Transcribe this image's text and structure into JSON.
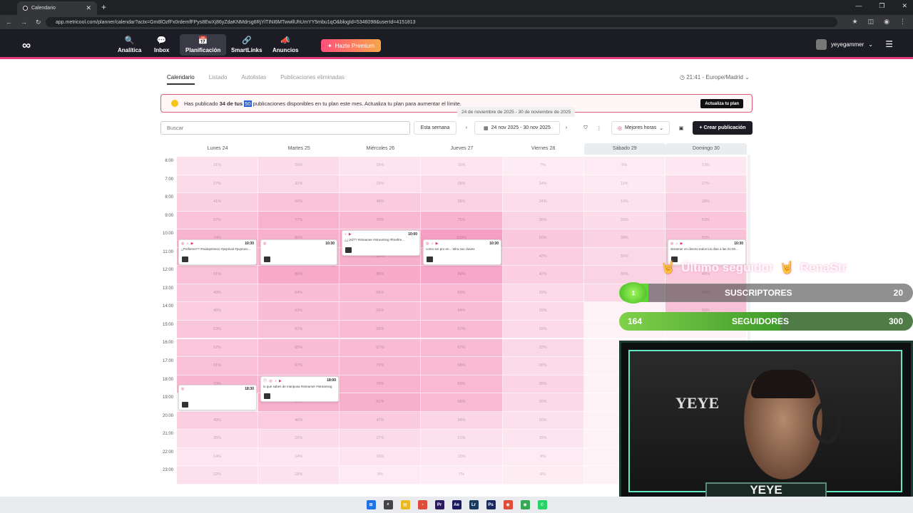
{
  "browser": {
    "tab_title": "Calendario",
    "url": "app.metricool.com/planner/calendar?actx=Gm8lOzfFx0rdemfFPys8EwXj86yZdaKNMdrsg6RjYiTINI6MTwwllUhUmYY5mbu1qO&blogId=5346098&userId=4151813"
  },
  "header": {
    "logo": "∞",
    "nav": [
      {
        "label": "Analítica",
        "icon": "🔍"
      },
      {
        "label": "Inbox",
        "icon": "💬"
      },
      {
        "label": "Planificación",
        "icon": "📅"
      },
      {
        "label": "SmartLinks",
        "icon": "🔗"
      },
      {
        "label": "Anuncios",
        "icon": "📣"
      }
    ],
    "premium_label": "Hazte Premium",
    "username": "yeyegammer"
  },
  "subtabs": [
    "Calendario",
    "Listado",
    "Autolistas",
    "Publicaciones eliminadas"
  ],
  "timezone": "21:41 - Europe/Madrid",
  "banner": {
    "pre": "Has publicado",
    "bold": "34 de tus",
    "highlight": "50",
    "post": "publicaciones disponibles en tu plan este mes. Actualiza tu plan para aumentar el límite.",
    "button": "Actualiza tu plan"
  },
  "tooltip": "24 de noviembre de 2025 - 30 de noviembre de 2025",
  "toolbar": {
    "search_placeholder": "Buscar",
    "this_week": "Esta semana",
    "range": "24 nov 2025 - 30 nov 2025",
    "best_hours": "Mejores horas",
    "create": "+ Crear publicación"
  },
  "days": [
    "Lunes 24",
    "Martes 25",
    "Miércoles 26",
    "Jueves 27",
    "Viernes 28",
    "Sábado 29",
    "Domingo 30"
  ],
  "hours": [
    "6:00",
    "7:00",
    "8:00",
    "9:00",
    "10:00",
    "11:00",
    "12:00",
    "13:00",
    "14:00",
    "15:00",
    "16:00",
    "17:00",
    "18:00",
    "19:00",
    "20:00",
    "21:00",
    "22:00",
    "23:00"
  ],
  "heat": [
    [
      "21%",
      "26%",
      "15%",
      "16%",
      "7%",
      "9%",
      "13%"
    ],
    [
      "27%",
      "31%",
      "23%",
      "28%",
      "14%",
      "11%",
      "27%"
    ],
    [
      "41%",
      "56%",
      "48%",
      "38%",
      "24%",
      "19%",
      "38%"
    ],
    [
      "57%",
      "77%",
      "70%",
      "75%",
      "36%",
      "26%",
      "53%"
    ],
    [
      "74%",
      "80%",
      "80%",
      "100%",
      "50%",
      "38%",
      "59%"
    ],
    [
      "75%",
      "72%",
      "80%",
      "80%",
      "42%",
      "32%",
      "55%"
    ],
    [
      "61%",
      "86%",
      "86%",
      "89%",
      "42%",
      "36%",
      "48%"
    ],
    [
      "49%",
      "64%",
      "66%",
      "69%",
      "29%",
      "31%",
      "54%"
    ],
    [
      "46%",
      "63%",
      "63%",
      "64%",
      "29%",
      "",
      "59%"
    ],
    [
      "53%",
      "61%",
      "68%",
      "67%",
      "29%",
      "",
      ""
    ],
    [
      "52%",
      "65%",
      "67%",
      "67%",
      "32%",
      "",
      ""
    ],
    [
      "61%",
      "67%",
      "70%",
      "68%",
      "28%",
      "",
      ""
    ],
    [
      "73%",
      "72%",
      "76%",
      "69%",
      "35%",
      "",
      ""
    ],
    [
      "",
      "80%",
      "81%",
      "68%",
      "30%",
      "",
      ""
    ],
    [
      "43%",
      "46%",
      "47%",
      "34%",
      "20%",
      "",
      ""
    ],
    [
      "25%",
      "26%",
      "27%",
      "21%",
      "15%",
      "",
      ""
    ],
    [
      "14%",
      "14%",
      "16%",
      "13%",
      "9%",
      "",
      ""
    ],
    [
      "22%",
      "18%",
      "9%",
      "7%",
      "6%",
      "",
      ""
    ]
  ],
  "posts": [
    {
      "time": "10:30",
      "icons": "◎ ♪ ▶",
      "text": "¿Prefieres?? #ruidoprimero #pvprival #pvprunc..."
    },
    {
      "time": "10:30",
      "icons": "◎",
      "text": ""
    },
    {
      "time": "10:00",
      "icons": "♪ ▶",
      "text": "¿¿¡Xd?? #streamer #streaming #freefire..."
    },
    {
      "time": "10:30",
      "icons": "◎ ♪ ▶",
      "text": "como ser pro en... Mira sus claves"
    },
    {
      "time": "10:30",
      "icons": "◎ ♪ ▶",
      "text": "streamer en directo todos los días a las 21:00..."
    },
    {
      "time": "18:30",
      "icons": "◎",
      "text": ""
    },
    {
      "time": "18:00",
      "icons": "ⓕ ◎ ♪ ▶",
      "text": "lo que sabes de mariposa #streamer #streaming"
    }
  ],
  "overlay": {
    "last_follower": "Último seguidor",
    "last_name": "RenaStr",
    "subs_count": "1",
    "subs_label": "SUSCRIPTORES",
    "subs_goal": "20",
    "followers_count": "164",
    "followers_label": "SEGUIDORES",
    "followers_goal": "300",
    "wall_text": "YEYE",
    "nameplate": "YEYE"
  },
  "taskbar_apps": [
    "⊞",
    "⌕",
    "▤",
    "◔",
    "Pr",
    "Ae",
    "Lr",
    "Ps",
    "◉",
    "◉",
    "✆"
  ]
}
